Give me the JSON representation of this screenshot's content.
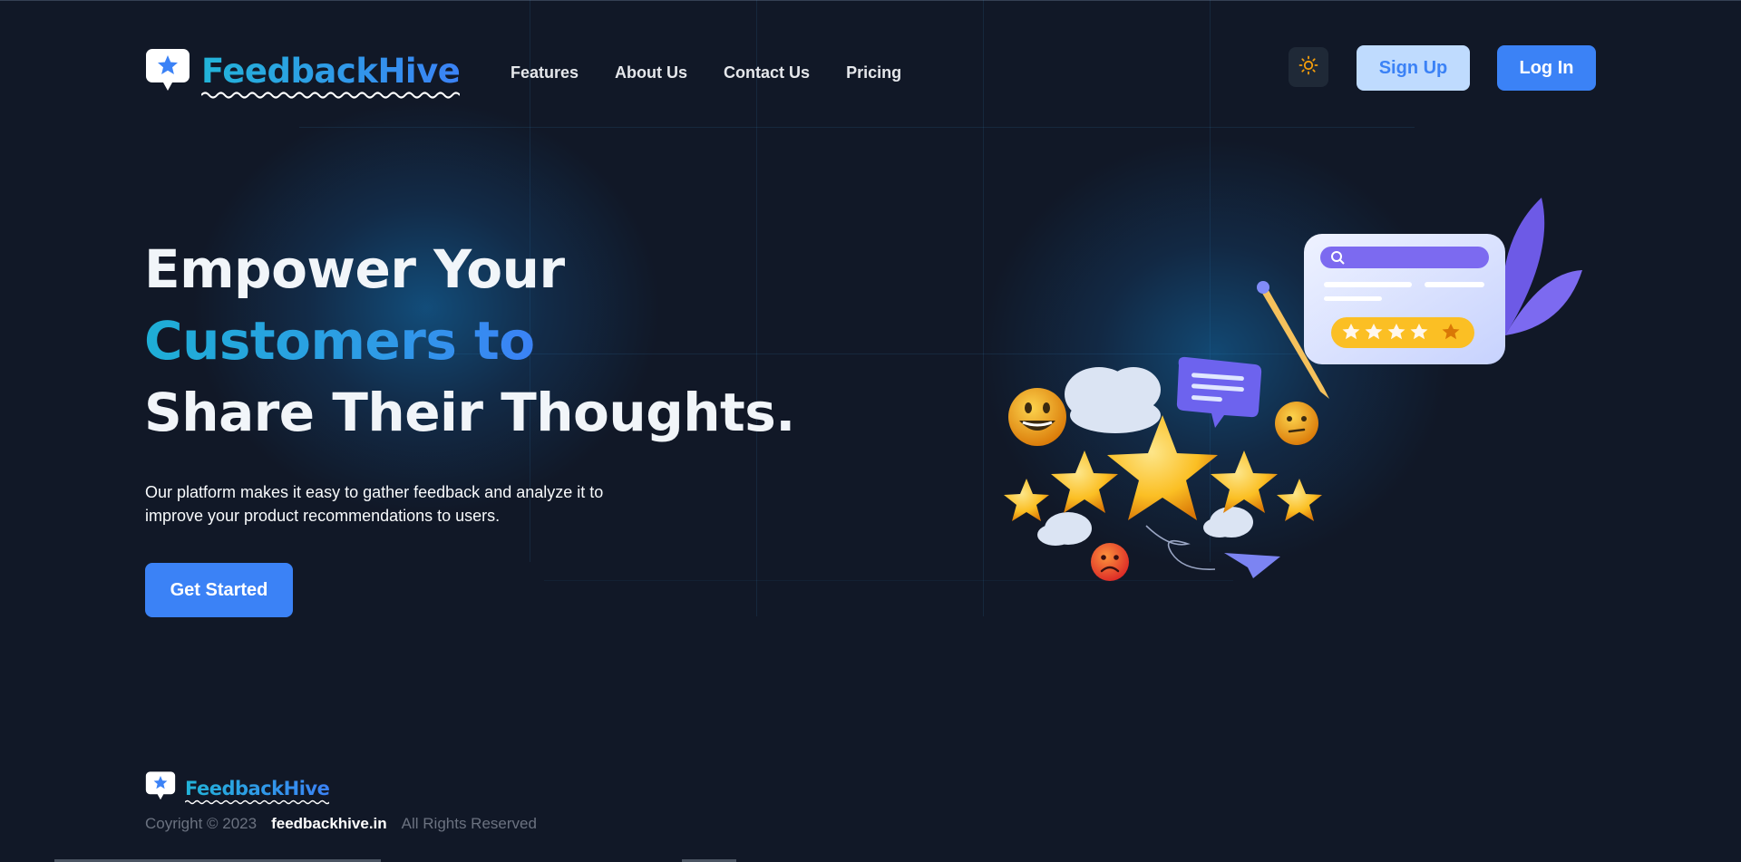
{
  "brand": {
    "name": "FeedbackHive",
    "gradient_from": "#22b4d8",
    "gradient_to": "#3b82f6",
    "icon": "star-chat-bubble-icon"
  },
  "nav": {
    "items": [
      {
        "label": "Features"
      },
      {
        "label": "About Us"
      },
      {
        "label": "Contact Us"
      },
      {
        "label": "Pricing"
      }
    ]
  },
  "header": {
    "theme_toggle_icon": "sun-icon",
    "signup_label": "Sign Up",
    "login_label": "Log In"
  },
  "hero": {
    "title_line1": "Empower Your",
    "title_line2": "Customers to",
    "title_line3": "Share Their Thoughts.",
    "description": "Our platform makes it easy to gather feedback and analyze it to improve your product recommendations to users.",
    "cta_label": "Get Started"
  },
  "illustration": {
    "description_icons": [
      "smiley-face-icon",
      "sad-face-icon",
      "neutral-face-icon",
      "star-icon",
      "chat-bubble-icon",
      "pencil-icon",
      "paper-plane-icon",
      "review-card-icon",
      "cloud-icon",
      "leaf-icon"
    ],
    "card_rating": 4.5
  },
  "footer": {
    "brand": "FeedbackHive",
    "copyright": "Coyright © 2023",
    "domain": "feedbackhive.in",
    "rights": "All Rights Reserved"
  },
  "colors": {
    "background": "#111827",
    "primary": "#3b82f6",
    "signup_bg": "#bfdbfe",
    "theme_button_bg": "#1f2937",
    "sun": "#f59e0b"
  }
}
